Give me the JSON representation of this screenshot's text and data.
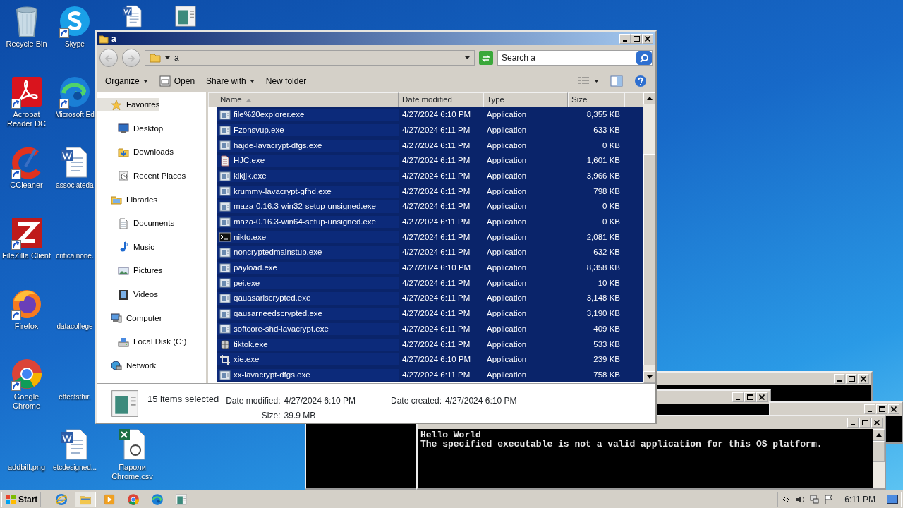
{
  "desktop": {
    "columns": [
      {
        "icons": [
          {
            "label": "Recycle Bin",
            "kind": "recycle",
            "shortcut": false
          },
          {
            "label": "Acrobat Reader DC",
            "kind": "acrobat",
            "shortcut": true
          },
          {
            "label": "CCleaner",
            "kind": "ccleaner",
            "shortcut": true
          },
          {
            "label": "FileZilla Client",
            "kind": "filezilla",
            "shortcut": true
          },
          {
            "label": "Firefox",
            "kind": "firefox",
            "shortcut": true
          },
          {
            "label": "Google Chrome",
            "kind": "chrome",
            "shortcut": true
          },
          {
            "label": "addbill.png",
            "kind": "blank",
            "shortcut": false
          }
        ]
      },
      {
        "icons": [
          {
            "label": "Skype",
            "kind": "skype",
            "shortcut": true
          },
          {
            "label": "Microsoft Ed",
            "kind": "edge",
            "shortcut": true
          },
          {
            "label": "associateda",
            "kind": "word",
            "shortcut": false
          },
          {
            "label": "criticalnone.",
            "kind": "blank",
            "shortcut": false
          },
          {
            "label": "datacollege",
            "kind": "blank",
            "shortcut": false
          },
          {
            "label": "effectsthir.",
            "kind": "blank",
            "shortcut": false
          },
          {
            "label": "etcdesigned...",
            "kind": "word",
            "shortcut": false
          }
        ]
      },
      {
        "icons": [
          {
            "kind": "word",
            "shortcut": false
          },
          {
            "label": "Пароли Chrome.csv",
            "kind": "csv",
            "shortcut": false
          }
        ]
      },
      {
        "icons": [
          {
            "kind": "appwin",
            "shortcut": false
          }
        ]
      }
    ]
  },
  "explorer": {
    "title": "a",
    "address": "a",
    "search": {
      "placeholder": "Search a"
    },
    "toolbar": [
      {
        "label": "Organize",
        "kind": "menu"
      },
      {
        "label": "Open",
        "kind": "open"
      },
      {
        "label": "Share with",
        "kind": "menu"
      },
      {
        "label": "New folder",
        "kind": "plain"
      }
    ],
    "nav": [
      {
        "label": "Favorites",
        "kind": "star",
        "selected": true,
        "children": [
          {
            "label": "Desktop",
            "kind": "desktop",
            "selected": false
          },
          {
            "label": "Downloads",
            "kind": "downloads",
            "selected": false
          },
          {
            "label": "Recent Places",
            "kind": "recent",
            "selected": false
          }
        ]
      },
      {
        "label": "Libraries",
        "kind": "libraries",
        "selected": false,
        "children": [
          {
            "label": "Documents",
            "kind": "documents",
            "selected": false
          },
          {
            "label": "Music",
            "kind": "music",
            "selected": false
          },
          {
            "label": "Pictures",
            "kind": "pictures",
            "selected": false
          },
          {
            "label": "Videos",
            "kind": "videos",
            "selected": false
          }
        ]
      },
      {
        "label": "Computer",
        "kind": "computer",
        "selected": false,
        "children": [
          {
            "label": "Local Disk (C:)",
            "kind": "disk",
            "selected": false
          }
        ]
      },
      {
        "label": "Network",
        "kind": "network",
        "selected": false
      }
    ],
    "columns": [
      {
        "label": "Name",
        "sorted": true
      },
      {
        "label": "Date modified",
        "sorted": false
      },
      {
        "label": "Type",
        "sorted": false
      },
      {
        "label": "Size",
        "sorted": false
      }
    ],
    "files": [
      {
        "name": "file%20explorer.exe",
        "date": "4/27/2024 6:10 PM",
        "type": "Application",
        "size": "8,355 KB",
        "kind": "app",
        "selected": true
      },
      {
        "name": "Fzonsvup.exe",
        "date": "4/27/2024 6:11 PM",
        "type": "Application",
        "size": "633 KB",
        "kind": "app",
        "selected": true
      },
      {
        "name": "hajde-lavacrypt-dfgs.exe",
        "date": "4/27/2024 6:11 PM",
        "type": "Application",
        "size": "0 KB",
        "kind": "app",
        "selected": true
      },
      {
        "name": "HJC.exe",
        "date": "4/27/2024 6:11 PM",
        "type": "Application",
        "size": "1,601 KB",
        "kind": "doc",
        "selected": true
      },
      {
        "name": "klkjjk.exe",
        "date": "4/27/2024 6:11 PM",
        "type": "Application",
        "size": "3,966 KB",
        "kind": "app",
        "selected": true
      },
      {
        "name": "krummy-lavacrypt-gfhd.exe",
        "date": "4/27/2024 6:11 PM",
        "type": "Application",
        "size": "798 KB",
        "kind": "app",
        "selected": true
      },
      {
        "name": "maza-0.16.3-win32-setup-unsigned.exe",
        "date": "4/27/2024 6:11 PM",
        "type": "Application",
        "size": "0 KB",
        "kind": "app",
        "selected": true
      },
      {
        "name": "maza-0.16.3-win64-setup-unsigned.exe",
        "date": "4/27/2024 6:11 PM",
        "type": "Application",
        "size": "0 KB",
        "kind": "app",
        "selected": true
      },
      {
        "name": "nikto.exe",
        "date": "4/27/2024 6:11 PM",
        "type": "Application",
        "size": "2,081 KB",
        "kind": "console",
        "selected": true
      },
      {
        "name": "noncryptedmainstub.exe",
        "date": "4/27/2024 6:11 PM",
        "type": "Application",
        "size": "632 KB",
        "kind": "app",
        "selected": true
      },
      {
        "name": "payload.exe",
        "date": "4/27/2024 6:10 PM",
        "type": "Application",
        "size": "8,358 KB",
        "kind": "app",
        "selected": true
      },
      {
        "name": "pei.exe",
        "date": "4/27/2024 6:11 PM",
        "type": "Application",
        "size": "10 KB",
        "kind": "app",
        "selected": true
      },
      {
        "name": "qauasariscrypted.exe",
        "date": "4/27/2024 6:11 PM",
        "type": "Application",
        "size": "3,148 KB",
        "kind": "app",
        "selected": true
      },
      {
        "name": "qausarneedscrypted.exe",
        "date": "4/27/2024 6:11 PM",
        "type": "Application",
        "size": "3,190 KB",
        "kind": "app",
        "selected": true
      },
      {
        "name": "softcore-shd-lavacrypt.exe",
        "date": "4/27/2024 6:11 PM",
        "type": "Application",
        "size": "409 KB",
        "kind": "app",
        "selected": true
      },
      {
        "name": "tiktok.exe",
        "date": "4/27/2024 6:11 PM",
        "type": "Application",
        "size": "533 KB",
        "kind": "package",
        "selected": true
      },
      {
        "name": "xie.exe",
        "date": "4/27/2024 6:10 PM",
        "type": "Application",
        "size": "239 KB",
        "kind": "crop",
        "selected": true
      },
      {
        "name": "xx-lavacrypt-dfgs.exe",
        "date": "4/27/2024 6:11 PM",
        "type": "Application",
        "size": "758 KB",
        "kind": "app",
        "selected": true
      }
    ],
    "details": {
      "summary": "15 items selected",
      "fields": [
        {
          "label": "Date modified:",
          "value": "4/27/2024 6:10 PM"
        },
        {
          "label": "Date created:",
          "value": "4/27/2024 6:10 PM"
        },
        {
          "label": "Size:",
          "value": "39.9 MB"
        }
      ]
    }
  },
  "console": {
    "lines": [
      "Hello World",
      "The specified executable is not a valid application for this OS platform."
    ]
  },
  "taskbar": {
    "start": "Start",
    "apps": [
      {
        "kind": "ie",
        "active": false
      },
      {
        "kind": "explorer",
        "active": true
      },
      {
        "kind": "media",
        "active": false
      },
      {
        "kind": "chrome",
        "active": false
      },
      {
        "kind": "edge",
        "active": false
      },
      {
        "kind": "appwin",
        "active": false
      }
    ],
    "clock": "6:11 PM"
  }
}
